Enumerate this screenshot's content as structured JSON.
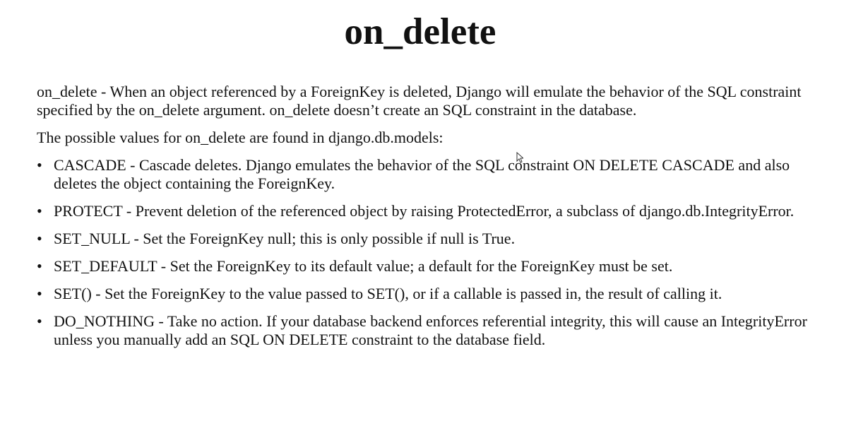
{
  "title": "on_delete",
  "intro": "on_delete - When an object referenced by a ForeignKey is deleted, Django will emulate the behavior of the SQL constraint specified by the on_delete argument. on_delete doesn’t create an SQL constraint in the database.",
  "values_intro": "The possible values for on_delete are found in django.db.models:",
  "bullet_symbol": "•",
  "items": [
    "CASCADE - Cascade deletes. Django emulates the behavior of the SQL constraint ON DELETE CASCADE and also deletes the object containing the ForeignKey.",
    "PROTECT - Prevent deletion of the referenced object by raising ProtectedError, a subclass of django.db.IntegrityError.",
    "SET_NULL - Set the ForeignKey null; this is only possible if null is True.",
    "SET_DEFAULT - Set the ForeignKey to its default value; a default for the ForeignKey must be set.",
    "SET() - Set the ForeignKey to the value passed to SET(), or if a callable is passed in, the result of calling it.",
    "DO_NOTHING - Take no action. If your database backend enforces referential integrity, this will cause an IntegrityError unless you manually add an SQL ON DELETE constraint to the database field."
  ],
  "cursor_icon": "mouse-pointer-icon"
}
